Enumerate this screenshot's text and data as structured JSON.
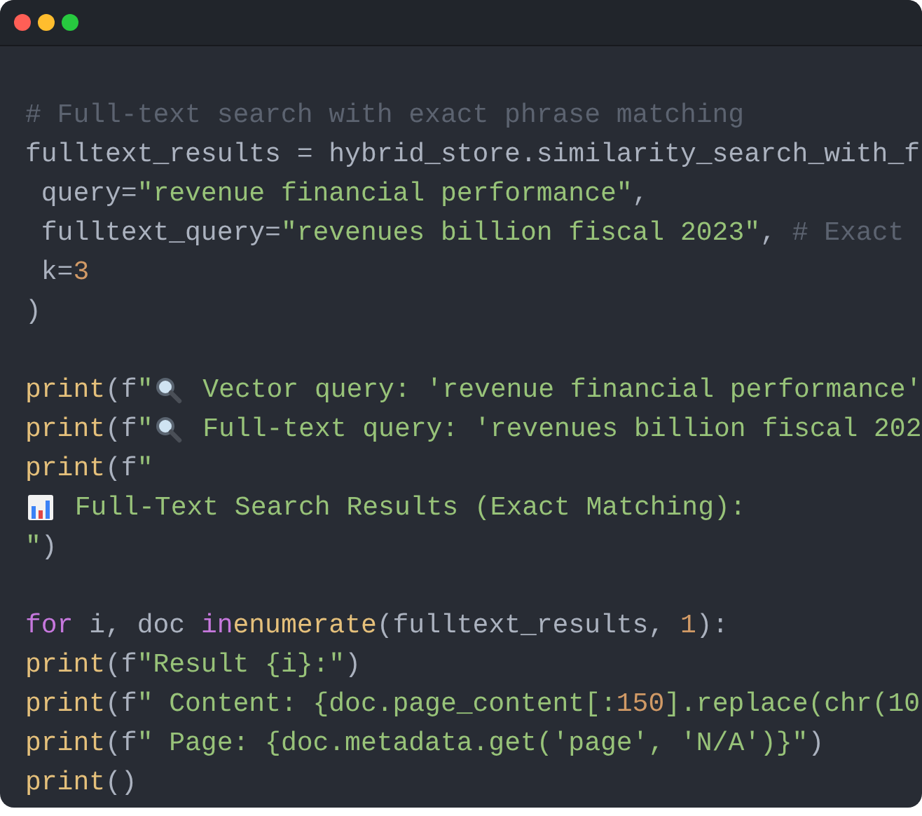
{
  "code": {
    "blocks": [
      {
        "lines": [
          {
            "tokens": [
              {
                "kind": "comment",
                "text": "# Full-text search with exact phrase matching"
              }
            ]
          },
          {
            "tokens": [
              {
                "kind": "text",
                "text": "fulltext_results = hybrid_store.similarity_search_with_f"
              }
            ]
          },
          {
            "tokens": [
              {
                "kind": "text",
                "text": " query="
              },
              {
                "kind": "string",
                "text": "\"revenue financial performance\""
              },
              {
                "kind": "text",
                "text": ","
              }
            ]
          },
          {
            "tokens": [
              {
                "kind": "text",
                "text": " fulltext_query="
              },
              {
                "kind": "string",
                "text": "\"revenues billion fiscal 2023\""
              },
              {
                "kind": "text",
                "text": ", "
              },
              {
                "kind": "comment",
                "text": "# Exact"
              }
            ]
          },
          {
            "tokens": [
              {
                "kind": "text",
                "text": " k="
              },
              {
                "kind": "number",
                "text": "3"
              }
            ]
          },
          {
            "tokens": [
              {
                "kind": "text",
                "text": ")"
              }
            ]
          }
        ]
      },
      {
        "lines": [
          {
            "tokens": [
              {
                "kind": "call",
                "text": "print"
              },
              {
                "kind": "text",
                "text": "(f"
              },
              {
                "kind": "string",
                "text": "\""
              },
              {
                "kind": "magnifier"
              },
              {
                "kind": "string",
                "text": " Vector query: 'revenue financial performance'"
              }
            ]
          },
          {
            "tokens": [
              {
                "kind": "call",
                "text": "print"
              },
              {
                "kind": "text",
                "text": "(f"
              },
              {
                "kind": "string",
                "text": "\""
              },
              {
                "kind": "magnifier"
              },
              {
                "kind": "string",
                "text": " Full-text query: 'revenues billion fiscal 202"
              }
            ]
          },
          {
            "tokens": [
              {
                "kind": "call",
                "text": "print"
              },
              {
                "kind": "text",
                "text": "(f"
              },
              {
                "kind": "string",
                "text": "\""
              }
            ]
          },
          {
            "tokens": [
              {
                "kind": "bar-chart"
              },
              {
                "kind": "string",
                "text": " Full-Text Search Results (Exact Matching):"
              }
            ]
          },
          {
            "tokens": [
              {
                "kind": "string",
                "text": "\""
              },
              {
                "kind": "text",
                "text": ")"
              }
            ]
          }
        ]
      },
      {
        "lines": [
          {
            "tokens": [
              {
                "kind": "keyword",
                "text": "for"
              },
              {
                "kind": "text",
                "text": " i, doc "
              },
              {
                "kind": "keyword",
                "text": "in"
              },
              {
                "kind": "call",
                "text": "enumerate"
              },
              {
                "kind": "text",
                "text": "(fulltext_results, "
              },
              {
                "kind": "number",
                "text": "1"
              },
              {
                "kind": "text",
                "text": "):"
              }
            ]
          },
          {
            "tokens": [
              {
                "kind": "call",
                "text": "print"
              },
              {
                "kind": "text",
                "text": "(f"
              },
              {
                "kind": "string",
                "text": "\"Result {i}:\""
              },
              {
                "kind": "text",
                "text": ")"
              }
            ]
          },
          {
            "tokens": [
              {
                "kind": "call",
                "text": "print"
              },
              {
                "kind": "text",
                "text": "(f"
              },
              {
                "kind": "string",
                "text": "\" Content: {doc.page_content[:"
              },
              {
                "kind": "number",
                "text": "150"
              },
              {
                "kind": "string",
                "text": "].replace(chr(10"
              }
            ]
          },
          {
            "tokens": [
              {
                "kind": "call",
                "text": "print"
              },
              {
                "kind": "text",
                "text": "(f"
              },
              {
                "kind": "string",
                "text": "\" Page: {doc.metadata.get('page', 'N/A')}\""
              },
              {
                "kind": "text",
                "text": ")"
              }
            ]
          },
          {
            "tokens": [
              {
                "kind": "call",
                "text": "print"
              },
              {
                "kind": "text",
                "text": "()"
              }
            ]
          }
        ]
      }
    ]
  }
}
